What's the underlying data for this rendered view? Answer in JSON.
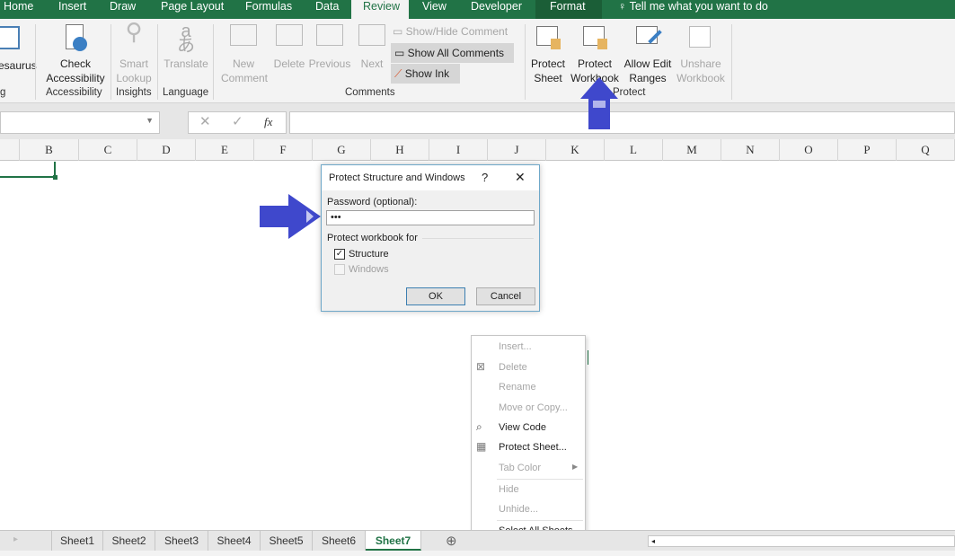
{
  "tabs": [
    "Home",
    "Insert",
    "Draw",
    "Page Layout",
    "Formulas",
    "Data",
    "Review",
    "View",
    "Developer",
    "Format"
  ],
  "tell_me": "Tell me what you want to do",
  "ribbon": {
    "thesaurus": "esaurus",
    "proofing_group": "g",
    "check_accessibility": [
      "Check",
      "Accessibility"
    ],
    "accessibility_group": "Accessibility",
    "smart_lookup": [
      "Smart",
      "Lookup"
    ],
    "insights_group": "Insights",
    "translate": "Translate",
    "language_group": "Language",
    "new_comment": [
      "New",
      "Comment"
    ],
    "delete": "Delete",
    "previous": "Previous",
    "next": "Next",
    "show_hide_comment": "Show/Hide Comment",
    "show_all_comments": "Show All Comments",
    "show_ink": "Show Ink",
    "comments_group": "Comments",
    "protect_sheet": [
      "Protect",
      "Sheet"
    ],
    "protect_workbook": [
      "Protect",
      "Workbook"
    ],
    "allow_edit_ranges": [
      "Allow Edit",
      "Ranges"
    ],
    "unshare_workbook": [
      "Unshare",
      "Workbook"
    ],
    "protect_group": "Protect"
  },
  "formula_bar": {
    "cancel": "✕",
    "enter": "✓",
    "fx": "fx",
    "value": ""
  },
  "columns": [
    "B",
    "C",
    "D",
    "E",
    "F",
    "G",
    "H",
    "I",
    "J",
    "K",
    "L",
    "M",
    "N",
    "O",
    "P",
    "Q"
  ],
  "dialog": {
    "title": "Protect Structure and Windows",
    "help": "?",
    "close": "✕",
    "password_label": "Password (optional):",
    "password_value": "•••",
    "section": "Protect workbook for",
    "structure": "Structure",
    "structure_checked": true,
    "windows": "Windows",
    "windows_checked": false,
    "ok": "OK",
    "cancel": "Cancel"
  },
  "context_menu": [
    {
      "label": "Insert...",
      "enabled": false
    },
    {
      "label": "Delete",
      "enabled": false,
      "icon": "delete-sheet-icon"
    },
    {
      "label": "Rename",
      "enabled": false
    },
    {
      "label": "Move or Copy...",
      "enabled": false
    },
    {
      "label": "View Code",
      "enabled": true,
      "icon": "view-code-icon"
    },
    {
      "label": "Protect Sheet...",
      "enabled": true,
      "icon": "protect-sheet-icon"
    },
    {
      "label": "Tab Color",
      "enabled": false,
      "submenu": true
    },
    {
      "label": "Hide",
      "enabled": false
    },
    {
      "label": "Unhide...",
      "enabled": false
    },
    {
      "label": "Select All Sheets",
      "enabled": true
    }
  ],
  "sheets": [
    "Sheet1",
    "Sheet2",
    "Sheet3",
    "Sheet4",
    "Sheet5",
    "Sheet6",
    "Sheet7"
  ],
  "active_sheet": "Sheet7",
  "colors": {
    "brand": "#217346",
    "arrow": "#3f48cc"
  }
}
